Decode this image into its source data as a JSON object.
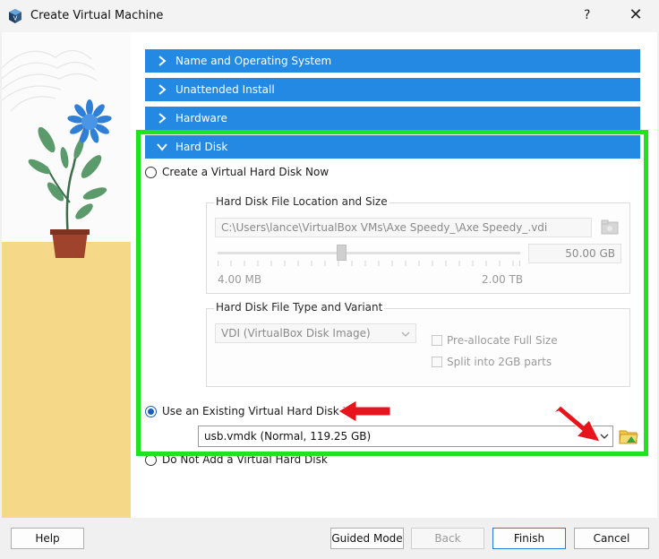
{
  "window": {
    "title": "Create Virtual Machine",
    "help_glyph": "?",
    "close_glyph": "✕"
  },
  "sections": {
    "name_os": "Name and Operating System",
    "unattended": "Unattended Install",
    "hardware": "Hardware",
    "hard_disk": "Hard Disk"
  },
  "hard_disk": {
    "create_new_label": "Create a Virtual Hard Disk Now",
    "location_group_title": "Hard Disk File Location and Size",
    "file_path": "C:\\Users\\lance\\VirtualBox VMs\\Axe Speedy_\\Axe Speedy_.vdi",
    "size_value": "50.00 GB",
    "size_min": "4.00 MB",
    "size_max": "2.00 TB",
    "size_fraction": 0.41,
    "type_group_title": "Hard Disk File Type and Variant",
    "disk_type": "VDI (VirtualBox Disk Image)",
    "preallocate_label": "Pre-allocate Full Size",
    "split_label": "Split into 2GB parts",
    "use_existing_label": "Use an Existing Virtual Hard Disk File",
    "existing_file": "usb.vmdk (Normal, 119.25 GB)",
    "no_disk_label": "Do Not Add a Virtual Hard Disk"
  },
  "buttons": {
    "help": "Help",
    "guided_mode": "Guided Mode",
    "back": "Back",
    "finish": "Finish",
    "cancel": "Cancel"
  },
  "colors": {
    "section_header": "#2389e3",
    "highlight_box": "#1ee41e",
    "annotation_arrow": "#e8141b"
  },
  "icons": {
    "app": "virtualbox-icon",
    "chevron": "chevron-right-icon",
    "folder_browse": "folder-browse-icon",
    "folder_disabled": "folder-disabled-icon"
  }
}
